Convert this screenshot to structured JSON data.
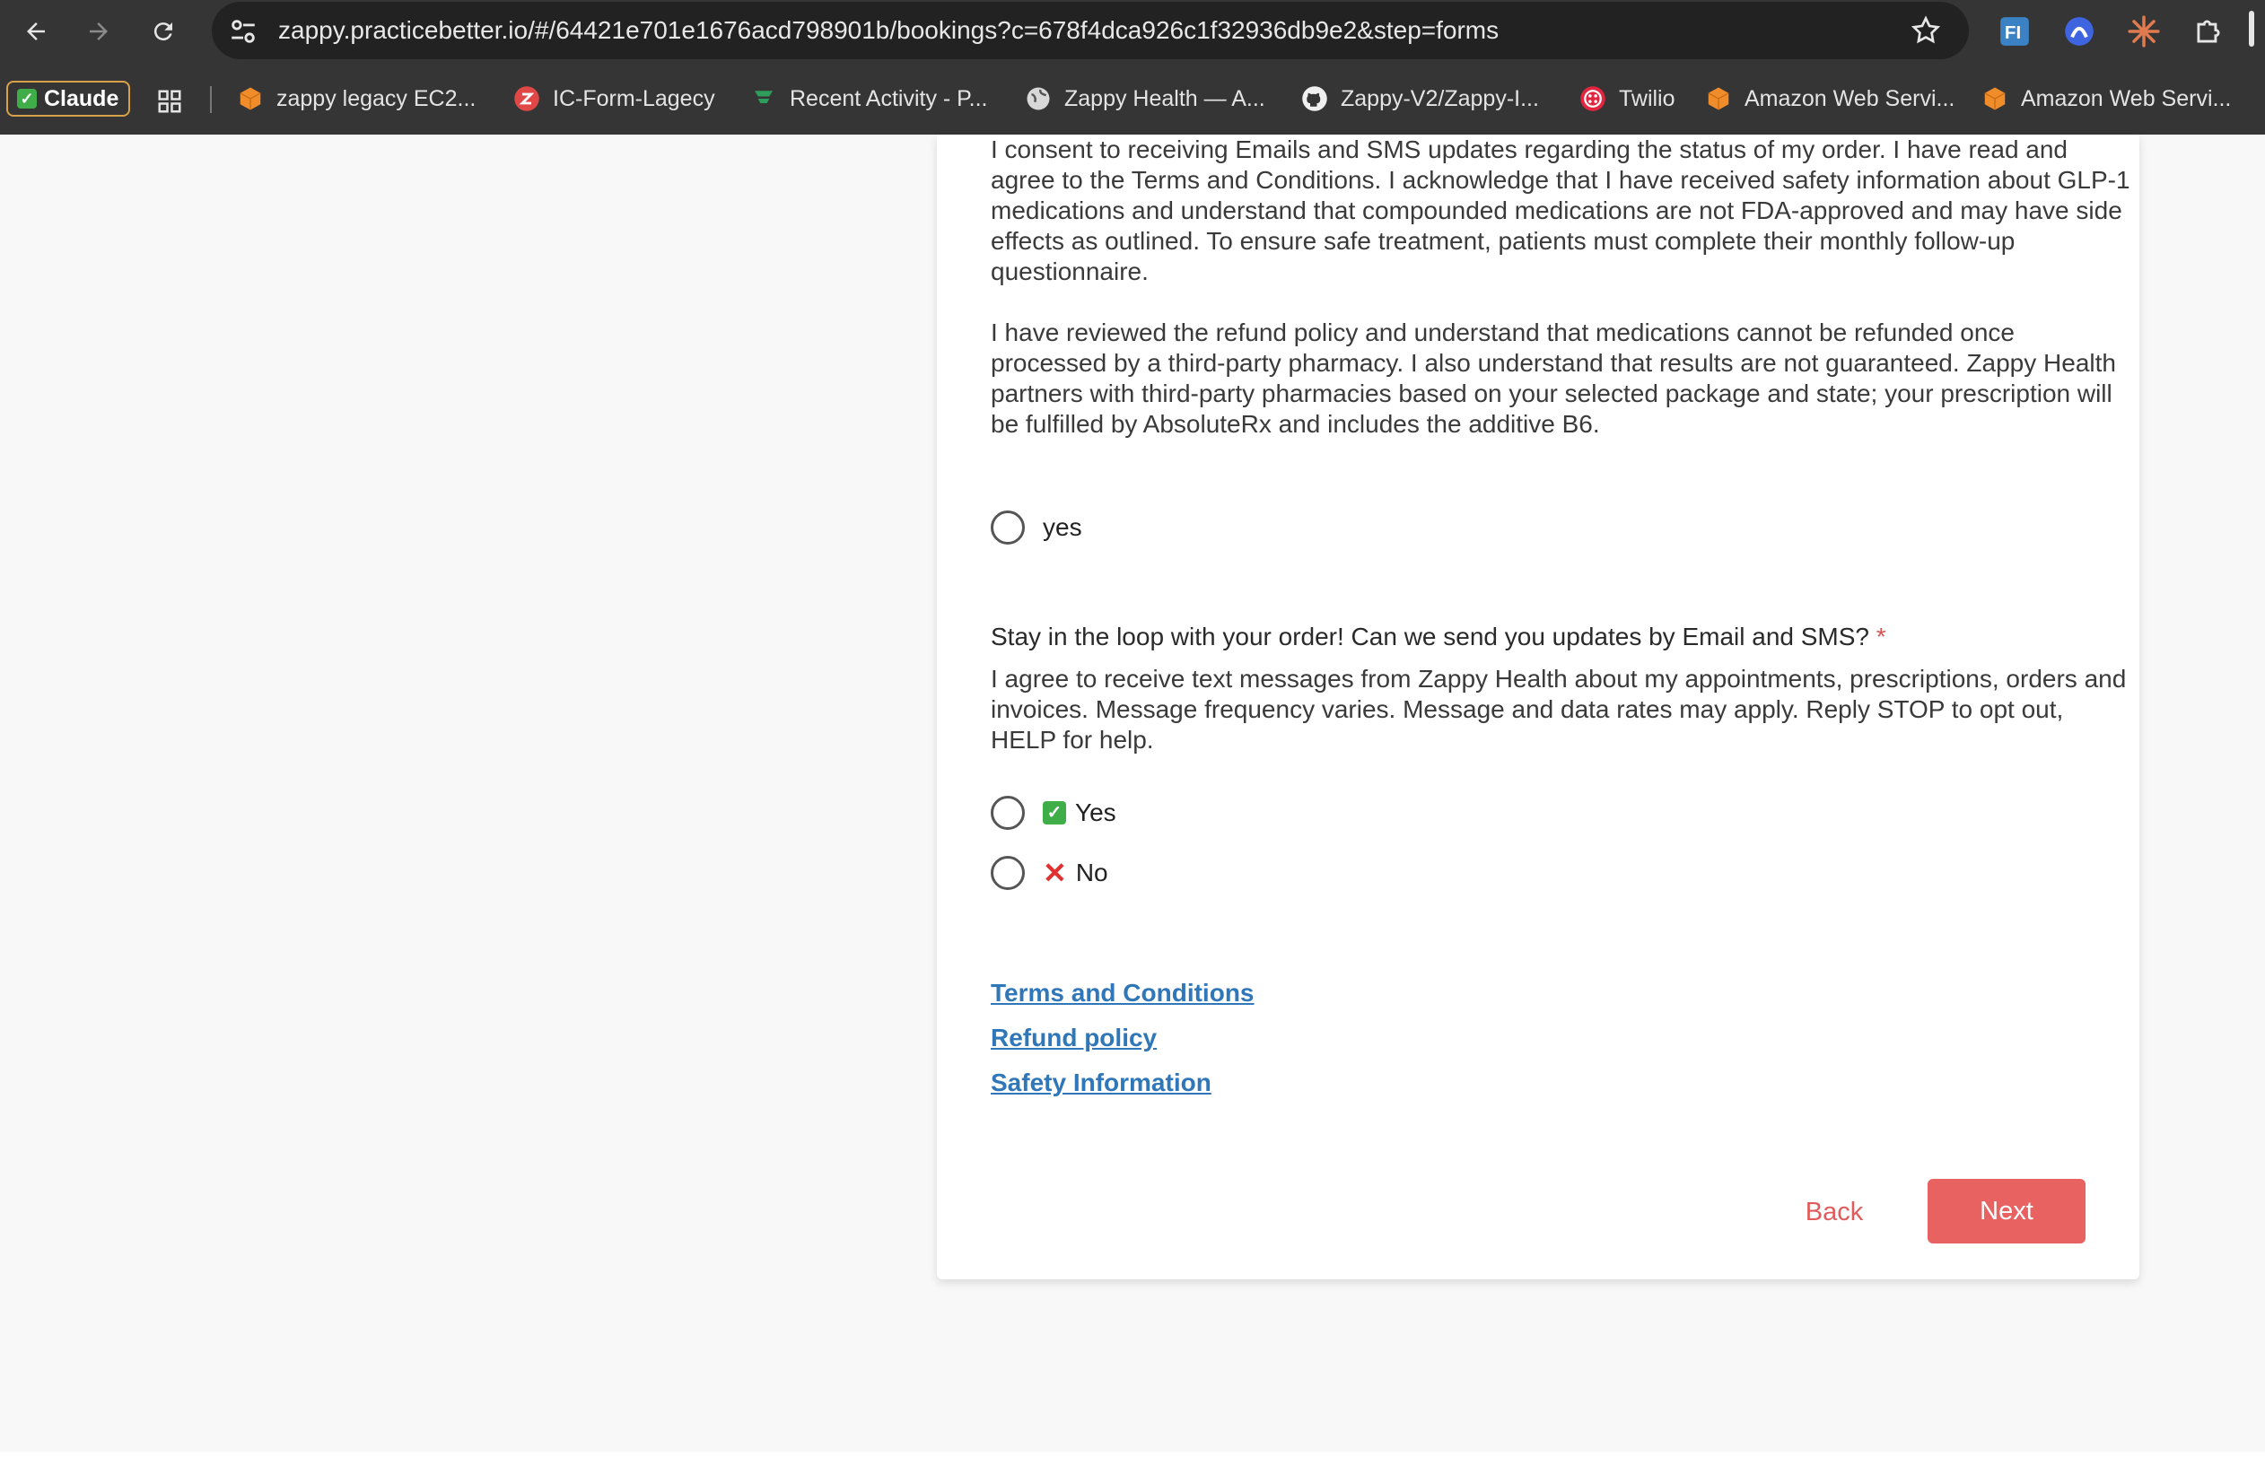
{
  "browser": {
    "url": "zappy.practicebetter.io/#/64421e701e1676acd798901b/bookings?c=678f4dca926c1f32936db9e2&step=forms",
    "bookmarks": [
      {
        "label": "Claude",
        "icon": "check-icon"
      },
      {
        "label": "zappy legacy EC2...",
        "icon": "aws-cube-icon"
      },
      {
        "label": "IC-Form-Lagecy",
        "icon": "z-logo-icon"
      },
      {
        "label": "Recent Activity - P...",
        "icon": "bars-icon"
      },
      {
        "label": "Zappy Health — A...",
        "icon": "globe-icon"
      },
      {
        "label": "Zappy-V2/Zappy-I...",
        "icon": "github-icon"
      },
      {
        "label": "Twilio",
        "icon": "twilio-icon"
      },
      {
        "label": "Amazon Web Servi...",
        "icon": "aws-cube-icon"
      },
      {
        "label": "Amazon Web Servi...",
        "icon": "aws-cube-icon"
      }
    ]
  },
  "form": {
    "consent_paragraph_1": "I consent to receiving Emails and SMS updates regarding the status of my order. I have read and agree to the Terms and Conditions. I acknowledge that I have received safety information about GLP-1 medications and understand that compounded medications are not FDA-approved and may have side effects as outlined.  To ensure safe treatment, patients must complete their monthly follow-up questionnaire.",
    "consent_paragraph_2": "I have reviewed the refund policy and understand that medications cannot be refunded once processed by a third-party pharmacy. I also understand that results are not guaranteed. Zappy Health partners with third-party pharmacies based on your selected package and state; your prescription will be fulfilled by AbsoluteRx and includes the additive B6.",
    "consent_option": "yes",
    "sms_question": "Stay in the loop with your order! Can we send you updates by Email and SMS?",
    "required_marker": "*",
    "sms_description": "I agree to receive text messages from Zappy Health about my appointments, prescriptions, orders and invoices. Message frequency varies. Message and data rates may apply. Reply STOP to opt out, HELP for help.",
    "sms_options": [
      {
        "label": "Yes",
        "icon": "check-mark-icon"
      },
      {
        "label": "No",
        "icon": "cross-mark-icon"
      }
    ],
    "links": [
      "Terms and Conditions",
      "Refund policy",
      "Safety Information"
    ],
    "back_label": "Back",
    "next_label": "Next"
  },
  "colors": {
    "primary": "#e86262",
    "link": "#2f77b8",
    "required": "#d9534f",
    "chrome": "#353535"
  }
}
